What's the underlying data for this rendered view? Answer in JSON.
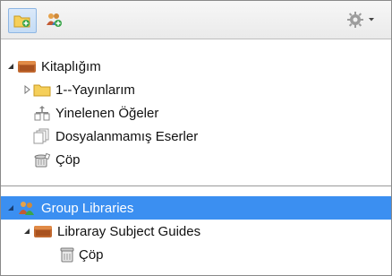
{
  "toolbar": {
    "new_collection_icon": "folder-add-icon",
    "new_group_icon": "group-add-icon",
    "actions_icon": "gear-icon"
  },
  "tree": {
    "my_library": {
      "label": "Kitaplığım",
      "expanded": true,
      "children": [
        {
          "label": "1--Yayınlarım",
          "icon": "folder-icon",
          "expanded": false
        },
        {
          "label": "Yinelenen Öğeler",
          "icon": "duplicate-items-icon"
        },
        {
          "label": "Dosyalanmamış Eserler",
          "icon": "unfiled-items-icon"
        },
        {
          "label": "Çöp",
          "icon": "trash-icon"
        }
      ]
    },
    "group_libraries": {
      "label": "Group Libraries",
      "selected": true,
      "expanded": true,
      "children": [
        {
          "label": "Libraray Subject Guides",
          "expanded": true,
          "children": [
            {
              "label": "Çöp",
              "icon": "trash-icon"
            }
          ]
        }
      ]
    }
  },
  "colors": {
    "selection": "#3b8ff1",
    "folder": "#f3c24b",
    "library": "#c0672e"
  }
}
